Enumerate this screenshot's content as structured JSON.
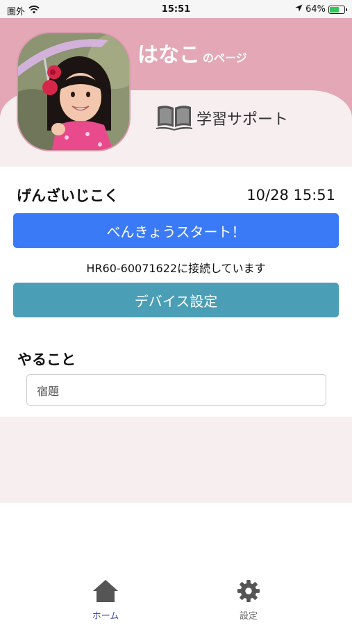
{
  "status_bar": {
    "carrier": "圏外",
    "time": "15:51",
    "battery": "64%",
    "battery_level": 0.64,
    "icons": [
      "wifi-icon",
      "location-arrow-icon",
      "battery-icon"
    ]
  },
  "header": {
    "name": "はなこ",
    "suffix": "のページ",
    "support_label": "学習サポート",
    "colors": {
      "header_bg": "#e4a7b6",
      "curve_bg": "#f7eef0"
    }
  },
  "clock": {
    "label": "げんざいじこく",
    "value": "10/28 15:51"
  },
  "buttons": {
    "start": "べんきょうスタート！",
    "device": "デバイス設定",
    "start_color": "#3a7af6",
    "device_color": "#4a9eb6"
  },
  "connection_text": "HR60-60071622に接続しています",
  "todo": {
    "title": "やること",
    "placeholder": "宿題"
  },
  "tabs": [
    {
      "label": "ホーム",
      "icon": "home-icon",
      "active": true
    },
    {
      "label": "設定",
      "icon": "gear-icon",
      "active": false
    }
  ]
}
